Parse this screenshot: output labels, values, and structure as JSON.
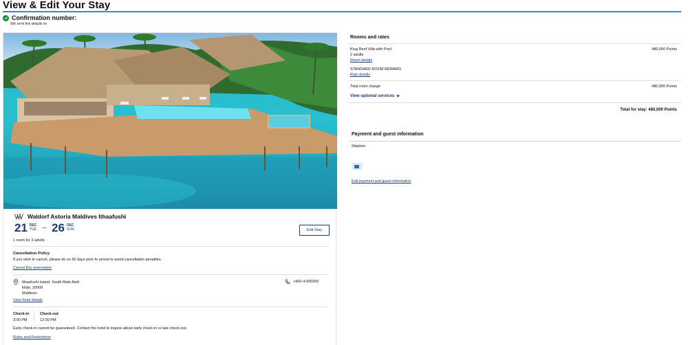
{
  "header": {
    "title": "View & Edit Your Stay"
  },
  "confirmation": {
    "label": "Confirmation number:",
    "sent_text": "We sent the details to"
  },
  "hotel": {
    "name": "Waldorf Astoria Maldives Ithaafushi",
    "checkin_day": "21",
    "checkin_month": "DEC",
    "checkin_weekday": "TUE",
    "checkout_day": "26",
    "checkout_month": "DEC",
    "checkout_weekday": "SUN",
    "edit_button": "Edit Stay",
    "rooms_guests": "1 room for 2 adults",
    "cancellation_title": "Cancellation Policy",
    "cancellation_text": "If you wish to cancel, please do so 30 days prior to arrival to avoid cancellation penalties.",
    "cancel_link": "Cancel this reservation",
    "address_line1": "Ithaafushi Island, South Male Atoll",
    "address_line2": "Male, 20009",
    "address_line3": "Maldives",
    "phone": "+960-4-000300",
    "view_details_link": "View hotel details",
    "checkin_label": "Check-in",
    "checkin_time": "3:00 PM",
    "checkout_label": "Check-out",
    "checkout_time": "12:00 PM",
    "early_text": "Early check-in cannot be guaranteed. Contact the hotel to inquire about early check-in or late check-out.",
    "rules_link": "Rules and Restrictions"
  },
  "rates": {
    "title": "Rooms and rates",
    "room_name": "King Reef Villa with Pool",
    "room_points": "480,000 Points",
    "adults": "2 adults",
    "room_details_link": "Room details",
    "rate_name": "STANDARD ROOM REWARD",
    "rate_details_link": "Rate details",
    "total_room_label": "Total room charge",
    "total_room_points": "480,000 Points",
    "optional_services": "View optional services",
    "total_stay": "Total for stay: 480,000 Points"
  },
  "payment": {
    "title": "Payment and guest information",
    "guest_name": "Stephen",
    "card_icon": "credit-card-icon",
    "edit_link": "Edit payment and guest information"
  },
  "colors": {
    "accent": "#2b8fd6",
    "navy": "#1c3a6e",
    "success": "#1b8a3c"
  }
}
